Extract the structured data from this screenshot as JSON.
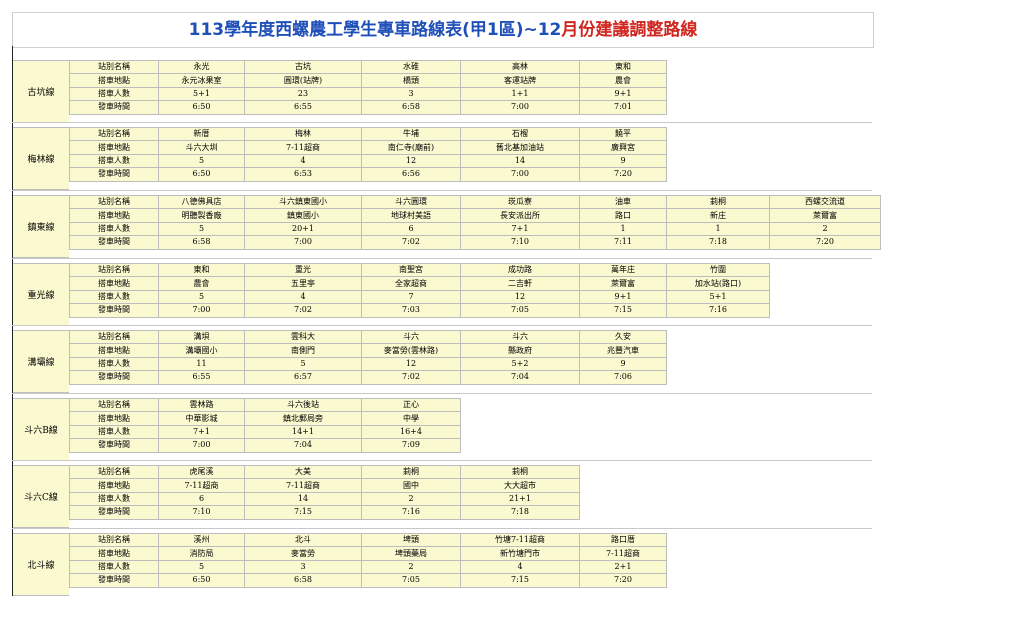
{
  "title": {
    "part1": "113學年度西螺農工學生專車路線表(甲1區)~12",
    "part2": "月份建議調整路線"
  },
  "row_headers": [
    "站別名稱",
    "搭車地點",
    "搭車人數",
    "發車時間"
  ],
  "routes": [
    {
      "name": "古坑線",
      "stations": [
        {
          "name": "永光",
          "place": "永元冰果室",
          "count": "5+1",
          "time": "6:50"
        },
        {
          "name": "古坑",
          "place": "圓環(站牌)",
          "count": "23",
          "time": "6:55"
        },
        {
          "name": "水碓",
          "place": "橋頭",
          "count": "3",
          "time": "6:58"
        },
        {
          "name": "高林",
          "place": "客運站牌",
          "count": "1+1",
          "time": "7:00"
        },
        {
          "name": "東和",
          "place": "農會",
          "count": "9+1",
          "time": "7:01"
        }
      ]
    },
    {
      "name": "梅林線",
      "stations": [
        {
          "name": "新厝",
          "place": "斗六大圳",
          "count": "5",
          "time": "6:50"
        },
        {
          "name": "梅林",
          "place": "7-11超商",
          "count": "4",
          "time": "6:53"
        },
        {
          "name": "牛埔",
          "place": "南仁寺(廟前)",
          "count": "12",
          "time": "6:56"
        },
        {
          "name": "石榴",
          "place": "舊北基加油站",
          "count": "14",
          "time": "7:00"
        },
        {
          "name": "饒平",
          "place": "廣興宮",
          "count": "9",
          "time": "7:20"
        }
      ]
    },
    {
      "name": "鎮東線",
      "stations": [
        {
          "name": "八德佛具店",
          "place": "明聽製香廠",
          "count": "5",
          "time": "6:58"
        },
        {
          "name": "斗六鎮東國小",
          "place": "鎮東國小",
          "count": "20+1",
          "time": "7:00"
        },
        {
          "name": "斗六圓環",
          "place": "地球村美語",
          "count": "6",
          "time": "7:02"
        },
        {
          "name": "崁瓜寮",
          "place": "長安派出所",
          "count": "7+1",
          "time": "7:10"
        },
        {
          "name": "油車",
          "place": "路口",
          "count": "1",
          "time": "7:11"
        },
        {
          "name": "莿桐",
          "place": "新庄",
          "count": "1",
          "time": "7:18"
        },
        {
          "name": "西螺交流道",
          "place": "萊爾富",
          "count": "2",
          "time": "7:20"
        }
      ]
    },
    {
      "name": "重光線",
      "stations": [
        {
          "name": "東和",
          "place": "農會",
          "count": "5",
          "time": "7:00"
        },
        {
          "name": "重光",
          "place": "五里亭",
          "count": "4",
          "time": "7:02"
        },
        {
          "name": "南聖宮",
          "place": "全家超商",
          "count": "7",
          "time": "7:03"
        },
        {
          "name": "成功路",
          "place": "二吉軒",
          "count": "12",
          "time": "7:05"
        },
        {
          "name": "萬年庄",
          "place": "萊爾富",
          "count": "9+1",
          "time": "7:15"
        },
        {
          "name": "竹圍",
          "place": "加水站(路口)",
          "count": "5+1",
          "time": "7:16"
        }
      ]
    },
    {
      "name": "溝壩線",
      "stations": [
        {
          "name": "溝垻",
          "place": "溝壩國小",
          "count": "11",
          "time": "6:55"
        },
        {
          "name": "雲科大",
          "place": "南側門",
          "count": "5",
          "time": "6:57"
        },
        {
          "name": "斗六",
          "place": "麥當勞(雲林路)",
          "count": "12",
          "time": "7:02"
        },
        {
          "name": "斗六",
          "place": "縣政府",
          "count": "5+2",
          "time": "7:04"
        },
        {
          "name": "久安",
          "place": "兆豐汽車",
          "count": "9",
          "time": "7:06"
        }
      ]
    },
    {
      "name": "斗六B線",
      "stations": [
        {
          "name": "雲林路",
          "place": "中華影城",
          "count": "7+1",
          "time": "7:00"
        },
        {
          "name": "斗六後站",
          "place": "鎮北郵局旁",
          "count": "14+1",
          "time": "7:04"
        },
        {
          "name": "正心",
          "place": "中學",
          "count": "16+4",
          "time": "7:09"
        }
      ]
    },
    {
      "name": "斗六C線",
      "stations": [
        {
          "name": "虎尾溪",
          "place": "7-11超商",
          "count": "6",
          "time": "7:10"
        },
        {
          "name": "大美",
          "place": "7-11超商",
          "count": "14",
          "time": "7:15"
        },
        {
          "name": "莿桐",
          "place": "國中",
          "count": "2",
          "time": "7:16"
        },
        {
          "name": "莿桐",
          "place": "大大超市",
          "count": "21+1",
          "time": "7:18"
        }
      ]
    },
    {
      "name": "北斗線",
      "stations": [
        {
          "name": "溪州",
          "place": "消防局",
          "count": "5",
          "time": "6:50"
        },
        {
          "name": "北斗",
          "place": "麥當勞",
          "count": "3",
          "time": "6:58"
        },
        {
          "name": "埤頭",
          "place": "埤頭藥局",
          "count": "2",
          "time": "7:05"
        },
        {
          "name": "竹塘7-11超商",
          "place": "新竹塘門市",
          "count": "4",
          "time": "7:15"
        },
        {
          "name": "路口厝",
          "place": "7-11超商",
          "count": "2+1",
          "time": "7:20"
        }
      ]
    }
  ]
}
